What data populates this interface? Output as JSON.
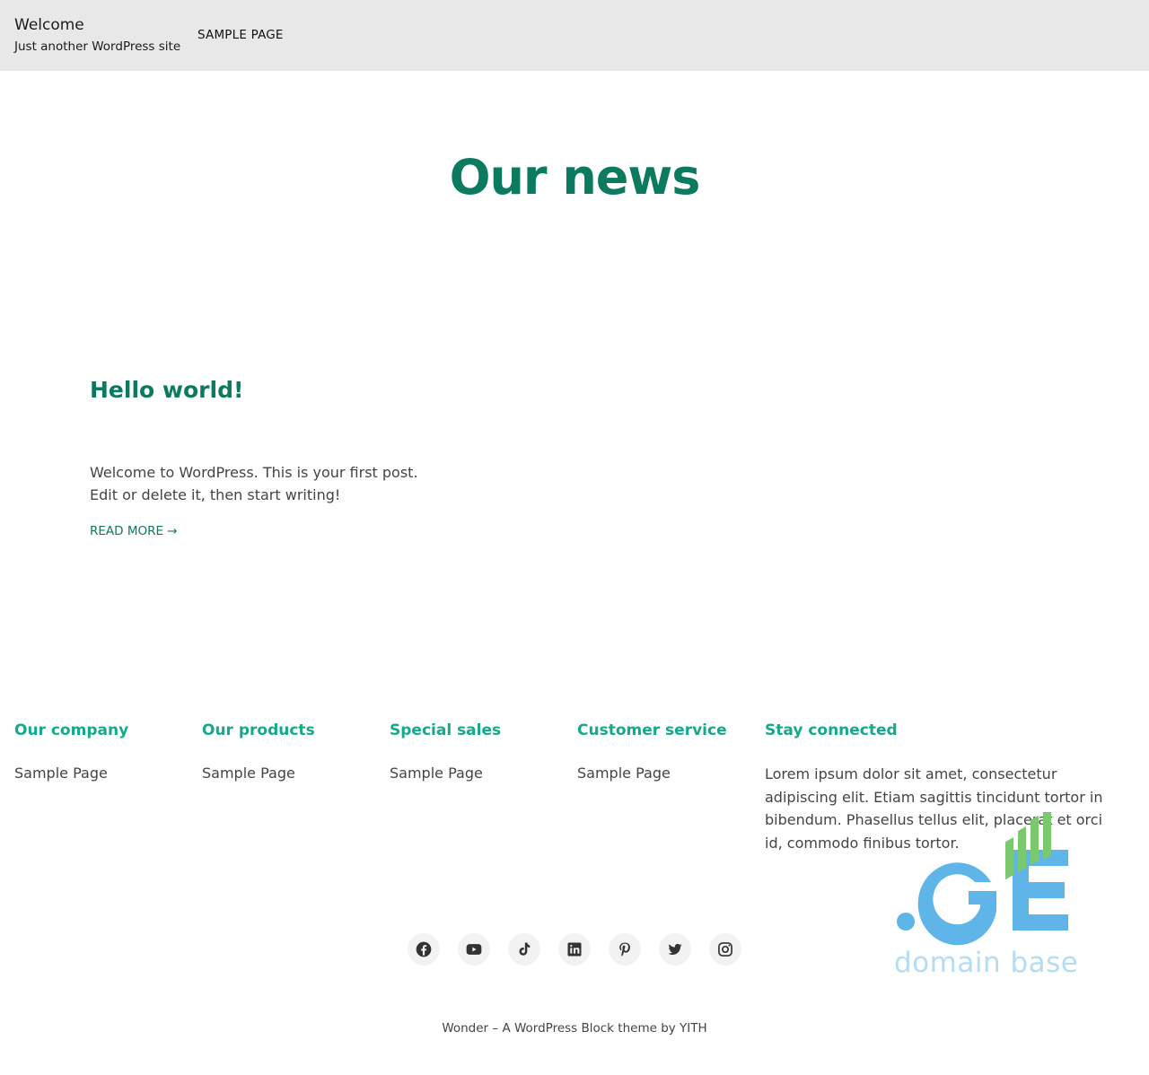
{
  "header": {
    "site_title": "Welcome",
    "tagline": "Just another WordPress site",
    "nav": [
      "SAMPLE PAGE"
    ]
  },
  "main": {
    "heading": "Our news",
    "post": {
      "title": "Hello world!",
      "excerpt": "Welcome to WordPress. This is your first post. Edit or delete it, then start writing!",
      "read_more": "READ MORE →"
    }
  },
  "footer": {
    "columns": [
      {
        "heading": "Our company",
        "link": "Sample Page"
      },
      {
        "heading": "Our products",
        "link": "Sample Page"
      },
      {
        "heading": "Special sales",
        "link": "Sample Page"
      },
      {
        "heading": "Customer service",
        "link": "Sample Page"
      }
    ],
    "stay_connected": {
      "heading": "Stay connected",
      "text": "Lorem ipsum dolor sit amet, consectetur adipiscing elit. Etiam sagittis tincidunt tortor in bibendum. Phasellus tellus elit, placerat et orci id, commodo finibus tortor."
    },
    "social_icons": [
      "facebook-icon",
      "youtube-icon",
      "tiktok-icon",
      "linkedin-icon",
      "pinterest-icon",
      "twitter-icon",
      "instagram-icon"
    ],
    "credit": "Wonder – A WordPress Block theme by YITH"
  },
  "watermark": {
    "logo_text": ".GE",
    "caption": "domain base"
  },
  "colors": {
    "accent_dark": "#0b7a5f",
    "accent_light": "#14a98a",
    "header_bg": "#e8e8e8",
    "watermark_blue": "#5fb4e8",
    "watermark_green": "#7bc96f"
  }
}
